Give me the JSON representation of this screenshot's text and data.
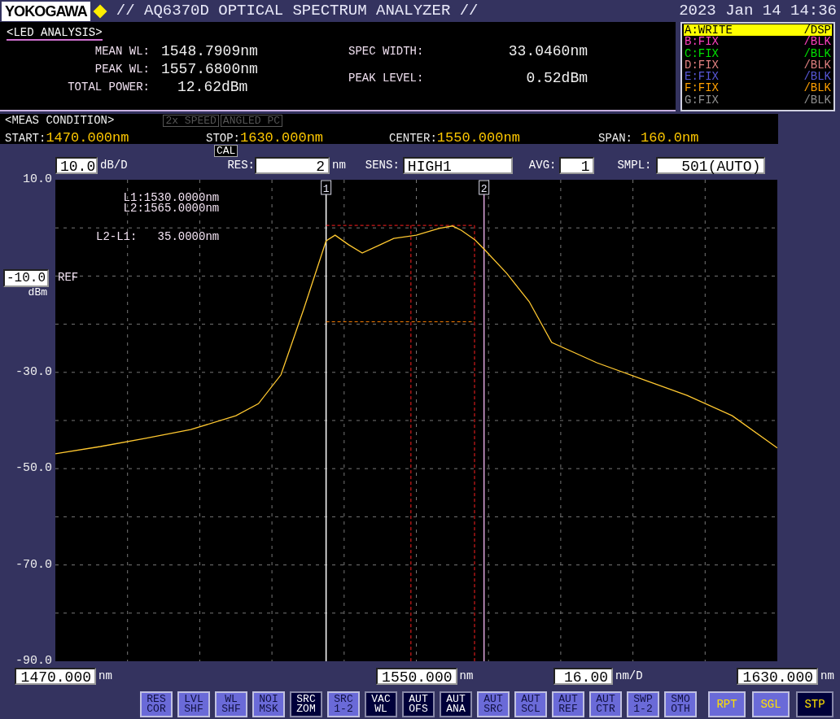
{
  "header": {
    "logo": "YOKOGAWA",
    "title": "// AQ6370D OPTICAL SPECTRUM ANALYZER //",
    "datetime": "2023 Jan 14 14:36"
  },
  "analysis": {
    "title": "<LED ANALYSIS>",
    "left": [
      {
        "label": "MEAN WL:",
        "value": "1548.7909nm"
      },
      {
        "label": "PEAK WL:",
        "value": "1557.6800nm"
      },
      {
        "label": "TOTAL POWER:",
        "value": "12.62dBm"
      }
    ],
    "right": [
      {
        "label": "SPEC WIDTH:",
        "value": "33.0460nm"
      },
      {
        "label": "PEAK LEVEL:",
        "value": "0.52dBm"
      }
    ]
  },
  "traces": [
    {
      "label": "A:WRITE",
      "status": "/DSP",
      "color": "#ffff00",
      "selected": true
    },
    {
      "label": "B:FIX",
      "status": "/BLK",
      "color": "#ff40c0",
      "selected": false
    },
    {
      "label": "C:FIX",
      "status": "/BLK",
      "color": "#00e000",
      "selected": false
    },
    {
      "label": "D:FIX",
      "status": "/BLK",
      "color": "#e08080",
      "selected": false
    },
    {
      "label": "E:FIX",
      "status": "/BLK",
      "color": "#5858d8",
      "selected": false
    },
    {
      "label": "F:FIX",
      "status": "/BLK",
      "color": "#ffa000",
      "selected": false
    },
    {
      "label": "G:FIX",
      "status": "/BLK",
      "color": "#909090",
      "selected": false
    }
  ],
  "meas_condition": {
    "title": "<MEAS CONDITION>",
    "flags": [
      {
        "label": "2x SPEED",
        "on": false
      },
      {
        "label": "ANGLED PC",
        "on": false
      }
    ],
    "params": [
      {
        "label": "START:",
        "value": "1470.000nm"
      },
      {
        "label": "STOP:",
        "value": "1630.000nm"
      },
      {
        "label": "CENTER:",
        "value": "1550.000nm"
      },
      {
        "label": "SPAN:",
        "value": "160.0nm"
      }
    ]
  },
  "settings": {
    "scale": {
      "value": "10.0",
      "unit": "dB/D"
    },
    "cal": "CAL",
    "res": {
      "label": "RES:",
      "value": "2",
      "unit": "nm"
    },
    "sens": {
      "label": "SENS:",
      "value": "HIGH1"
    },
    "avg": {
      "label": "AVG:",
      "value": "1"
    },
    "smpl": {
      "label": "SMPL:",
      "value": "501(AUTO)"
    }
  },
  "ref_level": {
    "value": "-10.0",
    "label": "REF",
    "unit": "dBm"
  },
  "marker_readout": [
    "L1:1530.0000nm",
    "L2:1565.0000nm",
    "L2-L1:   35.0000nm"
  ],
  "chart_data": {
    "type": "line",
    "xlim": [
      1470,
      1630
    ],
    "ylim": [
      -90,
      10
    ],
    "yticks": [
      {
        "value": 10,
        "label": "10.0"
      },
      {
        "value": -30,
        "label": "-30.0"
      },
      {
        "value": -50,
        "label": "-50.0"
      },
      {
        "value": -70,
        "label": "-70.0"
      },
      {
        "value": -90,
        "label": "-90.0"
      }
    ],
    "x": [
      1470,
      1480,
      1490,
      1500,
      1510,
      1515,
      1520,
      1525,
      1530,
      1532,
      1535,
      1538,
      1542,
      1545,
      1550,
      1555,
      1558,
      1560,
      1563,
      1565,
      1570,
      1575,
      1580,
      1590,
      1600,
      1610,
      1620,
      1630
    ],
    "series": [
      {
        "color": "#ffc830",
        "values": [
          -46.9,
          -45.4,
          -43.7,
          -41.9,
          -39.0,
          -36.5,
          -30.5,
          -17,
          -2.7,
          -1.5,
          -3.5,
          -5.2,
          -3.5,
          -2.2,
          -1.5,
          -0.1,
          0.4,
          -0.5,
          -2.5,
          -4.4,
          -9.4,
          -15.3,
          -23.8,
          -28,
          -31.4,
          -34.8,
          -39,
          -45.7
        ]
      }
    ],
    "xticks": [
      {
        "value": 1470,
        "label": "1470.000"
      },
      {
        "value": 1550,
        "label": "1550.000"
      },
      {
        "value": 1630,
        "label": "1630.000"
      }
    ],
    "grid": true,
    "ref_lines": [
      {
        "axis": "x",
        "value": 1530,
        "color": "#ffffff"
      },
      {
        "axis": "x",
        "value": 1565,
        "color": "#e0a8e0"
      },
      {
        "axis": "x",
        "value": 1562.9,
        "color": "#ff2020"
      },
      {
        "axis": "x",
        "value": 1548.8,
        "color": "#ff2020"
      },
      {
        "axis": "y",
        "value": 0.52,
        "color": "#ff2020"
      },
      {
        "axis": "y",
        "value": -19.5,
        "color": "#ff8000"
      }
    ],
    "annotations": [
      "1",
      "2"
    ]
  },
  "x_units": [
    "nm",
    "nm",
    "nm"
  ],
  "division": {
    "value": "16.00",
    "unit": "nm/D"
  },
  "soft_keys": [
    {
      "lines": [
        "RES",
        "COR"
      ],
      "selected": false
    },
    {
      "lines": [
        "LVL",
        "SHF"
      ],
      "selected": false
    },
    {
      "lines": [
        "WL",
        "SHF"
      ],
      "selected": false
    },
    {
      "lines": [
        "NOI",
        "MSK"
      ],
      "selected": false
    },
    {
      "lines": [
        "SRC",
        "ZOM"
      ],
      "selected": true
    },
    {
      "lines": [
        "SRC",
        "1-2"
      ],
      "selected": false
    },
    {
      "lines": [
        "VAC",
        "WL"
      ],
      "selected": true
    },
    {
      "lines": [
        "AUT",
        "OFS"
      ],
      "selected": true
    },
    {
      "lines": [
        "AUT",
        "ANA"
      ],
      "selected": true
    },
    {
      "lines": [
        "AUT",
        "SRC"
      ],
      "selected": false
    },
    {
      "lines": [
        "AUT",
        "SCL"
      ],
      "selected": false
    },
    {
      "lines": [
        "AUT",
        "REF"
      ],
      "selected": false
    },
    {
      "lines": [
        "AUT",
        "CTR"
      ],
      "selected": false
    },
    {
      "lines": [
        "SWP",
        "1-2"
      ],
      "selected": false
    },
    {
      "lines": [
        "SMO",
        "OTH"
      ],
      "selected": false
    }
  ],
  "sweep_keys": [
    {
      "label": "RPT",
      "selected": false
    },
    {
      "label": "SGL",
      "selected": false
    },
    {
      "label": "STP",
      "selected": true
    }
  ]
}
